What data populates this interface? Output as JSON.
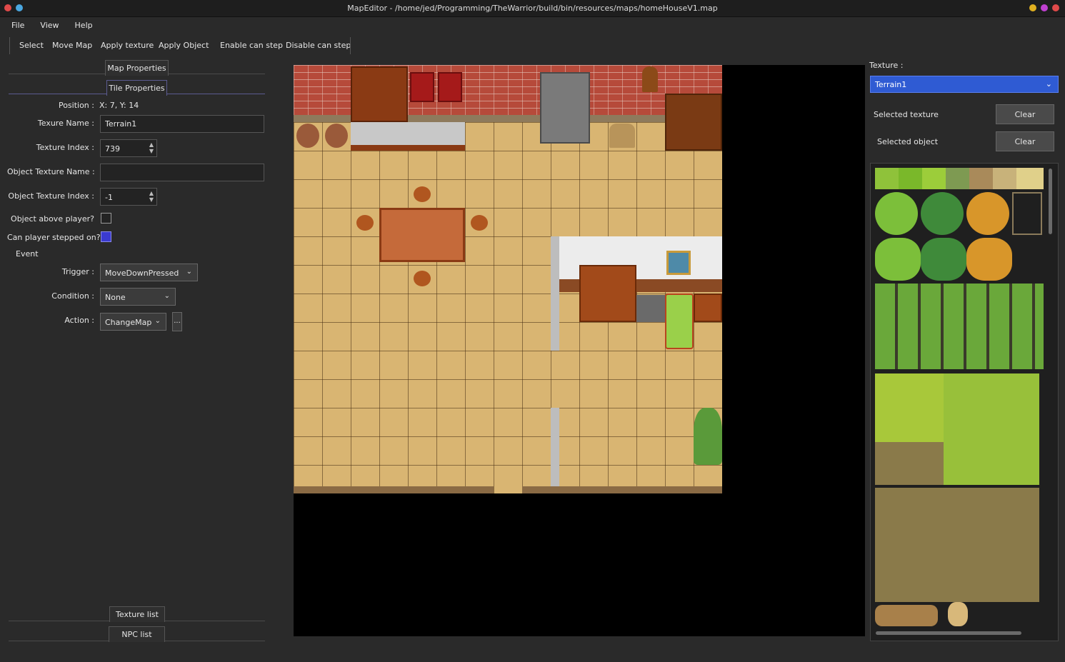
{
  "window": {
    "title": "MapEditor - /home/jed/Programming/TheWarrior/build/bin/resources/maps/homeHouseV1.map"
  },
  "menu": [
    "File",
    "View",
    "Help"
  ],
  "toolbar": [
    "Select",
    "Move Map",
    "Apply texture",
    "Apply Object",
    "Enable can step",
    "Disable can step"
  ],
  "left_panel": {
    "tab_map_properties": "Map Properties",
    "tab_tile_properties": "Tile Properties",
    "position_label": "Position :",
    "position_value": "X: 7, Y: 14",
    "texture_name_label": "Texure Name :",
    "texture_name_value": "Terrain1",
    "texture_index_label": "Texture Index :",
    "texture_index_value": "739",
    "object_texture_name_label": "Object Texture Name :",
    "object_texture_name_value": "",
    "object_texture_index_label": "Object Texture Index :",
    "object_texture_index_value": "-1",
    "object_above_player_label": "Object above player?",
    "object_above_player_checked": false,
    "can_step_label": "Can player stepped on?",
    "can_step_checked": true,
    "event_label": "Event",
    "trigger_label": "Trigger :",
    "trigger_value": "MoveDownPressed",
    "condition_label": "Condition :",
    "condition_value": "None",
    "action_label": "Action :",
    "action_value": "ChangeMap",
    "action_more": "...",
    "tab_texture_list": "Texture list",
    "tab_npc_list": "NPC list"
  },
  "right_panel": {
    "texture_label": "Texture :",
    "texture_value": "Terrain1",
    "selected_texture_label": "Selected texture",
    "selected_object_label": "Selected object",
    "clear_label": "Clear"
  },
  "colors": {
    "accent": "#2f5bd3",
    "floor": "#d9b572",
    "wall": "#b64a3a"
  }
}
